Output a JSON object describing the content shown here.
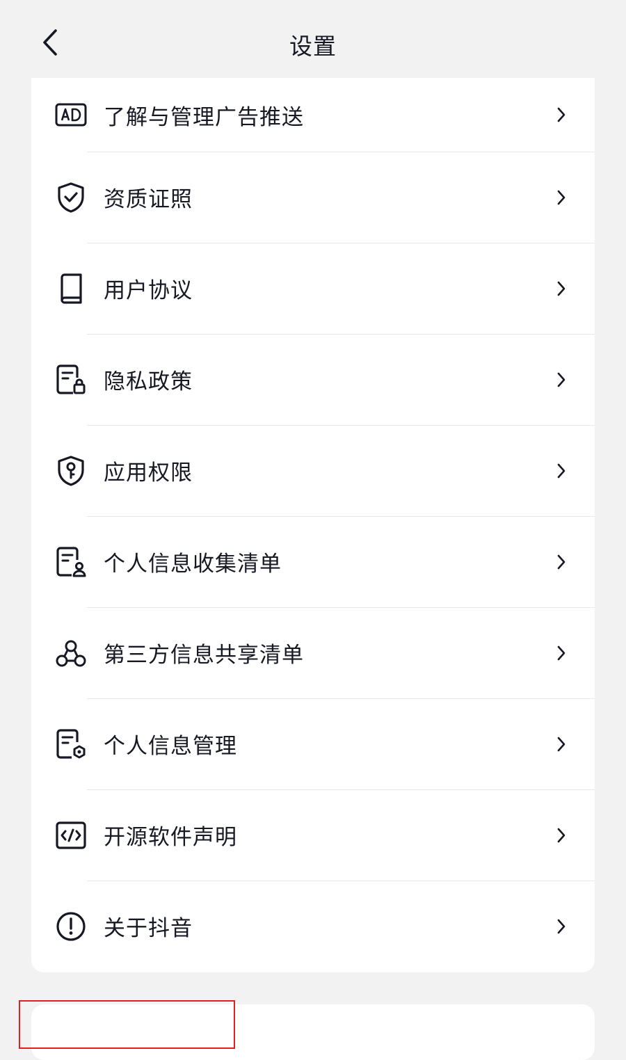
{
  "header": {
    "title": "设置",
    "back_icon": "chevron-left-icon"
  },
  "menu": [
    {
      "id": "ad",
      "label": "了解与管理广告推送",
      "icon": "ad-icon"
    },
    {
      "id": "license",
      "label": "资质证照",
      "icon": "shield-check-icon"
    },
    {
      "id": "agreement",
      "label": "用户协议",
      "icon": "book-icon"
    },
    {
      "id": "privacy",
      "label": "隐私政策",
      "icon": "document-lock-icon"
    },
    {
      "id": "permissions",
      "label": "应用权限",
      "icon": "shield-key-icon"
    },
    {
      "id": "info-collection",
      "label": "个人信息收集清单",
      "icon": "document-user-icon"
    },
    {
      "id": "third-party",
      "label": "第三方信息共享清单",
      "icon": "share-nodes-icon"
    },
    {
      "id": "info-management",
      "label": "个人信息管理",
      "icon": "document-gear-icon"
    },
    {
      "id": "open-source",
      "label": "开源软件声明",
      "icon": "code-icon"
    },
    {
      "id": "about",
      "label": "关于抖音",
      "icon": "info-exclamation-icon"
    }
  ],
  "colors": {
    "background": "#f2f2f2",
    "card": "#ffffff",
    "text": "#161823",
    "divider": "#e6e6e8",
    "highlight": "#e02020"
  }
}
